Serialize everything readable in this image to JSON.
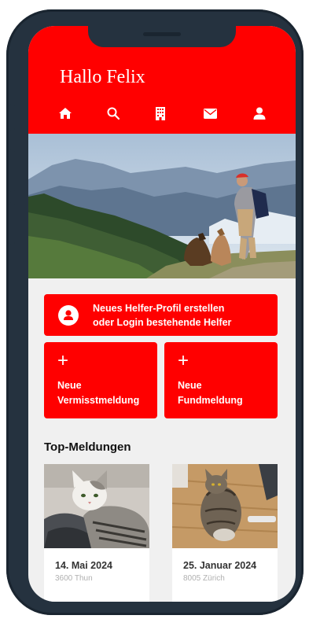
{
  "header": {
    "greeting": "Hallo Felix"
  },
  "nav": [
    {
      "icon": "home-icon"
    },
    {
      "icon": "search-icon"
    },
    {
      "icon": "building-icon"
    },
    {
      "icon": "mail-icon"
    },
    {
      "icon": "user-icon"
    }
  ],
  "cta": {
    "line1": "Neues Helfer-Profil erstellen",
    "line2": "oder Login bestehende Helfer"
  },
  "tiles": [
    {
      "plus": "+",
      "line1": "Neue",
      "line2": "Vermisstmeldung"
    },
    {
      "plus": "+",
      "line1": "Neue",
      "line2": "Fundmeldung"
    }
  ],
  "section": {
    "title": "Top-Meldungen"
  },
  "cards": [
    {
      "date": "14. Mai 2024",
      "place": "3600 Thun"
    },
    {
      "date": "25. Januar 2024",
      "place": "8005 Zürich"
    }
  ],
  "colors": {
    "accent": "#ff0000",
    "frame": "#25323f",
    "background": "#f0f0f0"
  }
}
